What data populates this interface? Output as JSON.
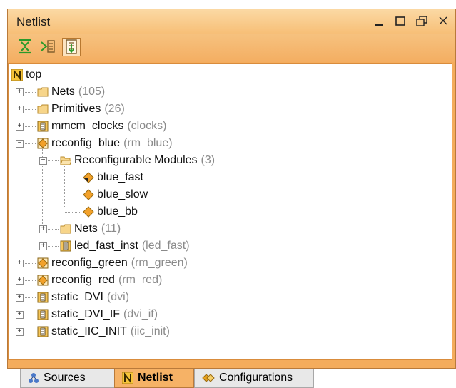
{
  "window": {
    "title": "Netlist",
    "buttons": [
      "minimize",
      "maximize",
      "restore",
      "close"
    ]
  },
  "toolbar": {
    "buttons": [
      "collapse-all-icon",
      "expand-all-icon",
      "auto-scroll-icon"
    ]
  },
  "tree": {
    "root": "top",
    "nodes": [
      {
        "name": "Nets",
        "sub": "(105)",
        "icon": "folder",
        "level": 1,
        "expander": "+"
      },
      {
        "name": "Primitives",
        "sub": "(26)",
        "icon": "folder",
        "level": 1,
        "expander": "+"
      },
      {
        "name": "mmcm_clocks",
        "sub": "(clocks)",
        "icon": "module",
        "level": 1,
        "expander": "+"
      },
      {
        "name": "reconfig_blue",
        "sub": "(rm_blue)",
        "icon": "partition",
        "level": 1,
        "expander": "-"
      },
      {
        "name": "Reconfigurable Modules",
        "sub": "(3)",
        "icon": "folder-open",
        "level": 2,
        "expander": "-"
      },
      {
        "name": "blue_fast",
        "sub": "",
        "icon": "rm-active",
        "level": 3,
        "expander": ""
      },
      {
        "name": "blue_slow",
        "sub": "",
        "icon": "rm",
        "level": 3,
        "expander": ""
      },
      {
        "name": "blue_bb",
        "sub": "",
        "icon": "rm",
        "level": 3,
        "expander": ""
      },
      {
        "name": "Nets",
        "sub": "(11)",
        "icon": "folder",
        "level": 2,
        "expander": "+"
      },
      {
        "name": "led_fast_inst",
        "sub": "(led_fast)",
        "icon": "module",
        "level": 2,
        "expander": "+"
      },
      {
        "name": "reconfig_green",
        "sub": "(rm_green)",
        "icon": "partition",
        "level": 1,
        "expander": "+"
      },
      {
        "name": "reconfig_red",
        "sub": "(rm_red)",
        "icon": "partition",
        "level": 1,
        "expander": "+"
      },
      {
        "name": "static_DVI",
        "sub": "(dvi)",
        "icon": "module",
        "level": 1,
        "expander": "+"
      },
      {
        "name": "static_DVI_IF",
        "sub": "(dvi_if)",
        "icon": "module",
        "level": 1,
        "expander": "+"
      },
      {
        "name": "static_IIC_INIT",
        "sub": "(iic_init)",
        "icon": "module",
        "level": 1,
        "expander": "+"
      }
    ]
  },
  "tabs": [
    {
      "label": "Sources",
      "icon": "sources-icon",
      "active": false
    },
    {
      "label": "Netlist",
      "icon": "netlist-icon",
      "active": true
    },
    {
      "label": "Configurations",
      "icon": "configurations-icon",
      "active": false
    }
  ],
  "colors": {
    "accent": "#f4ac5c",
    "subtext": "#8a8a8a",
    "partition": "#f2a12a"
  }
}
